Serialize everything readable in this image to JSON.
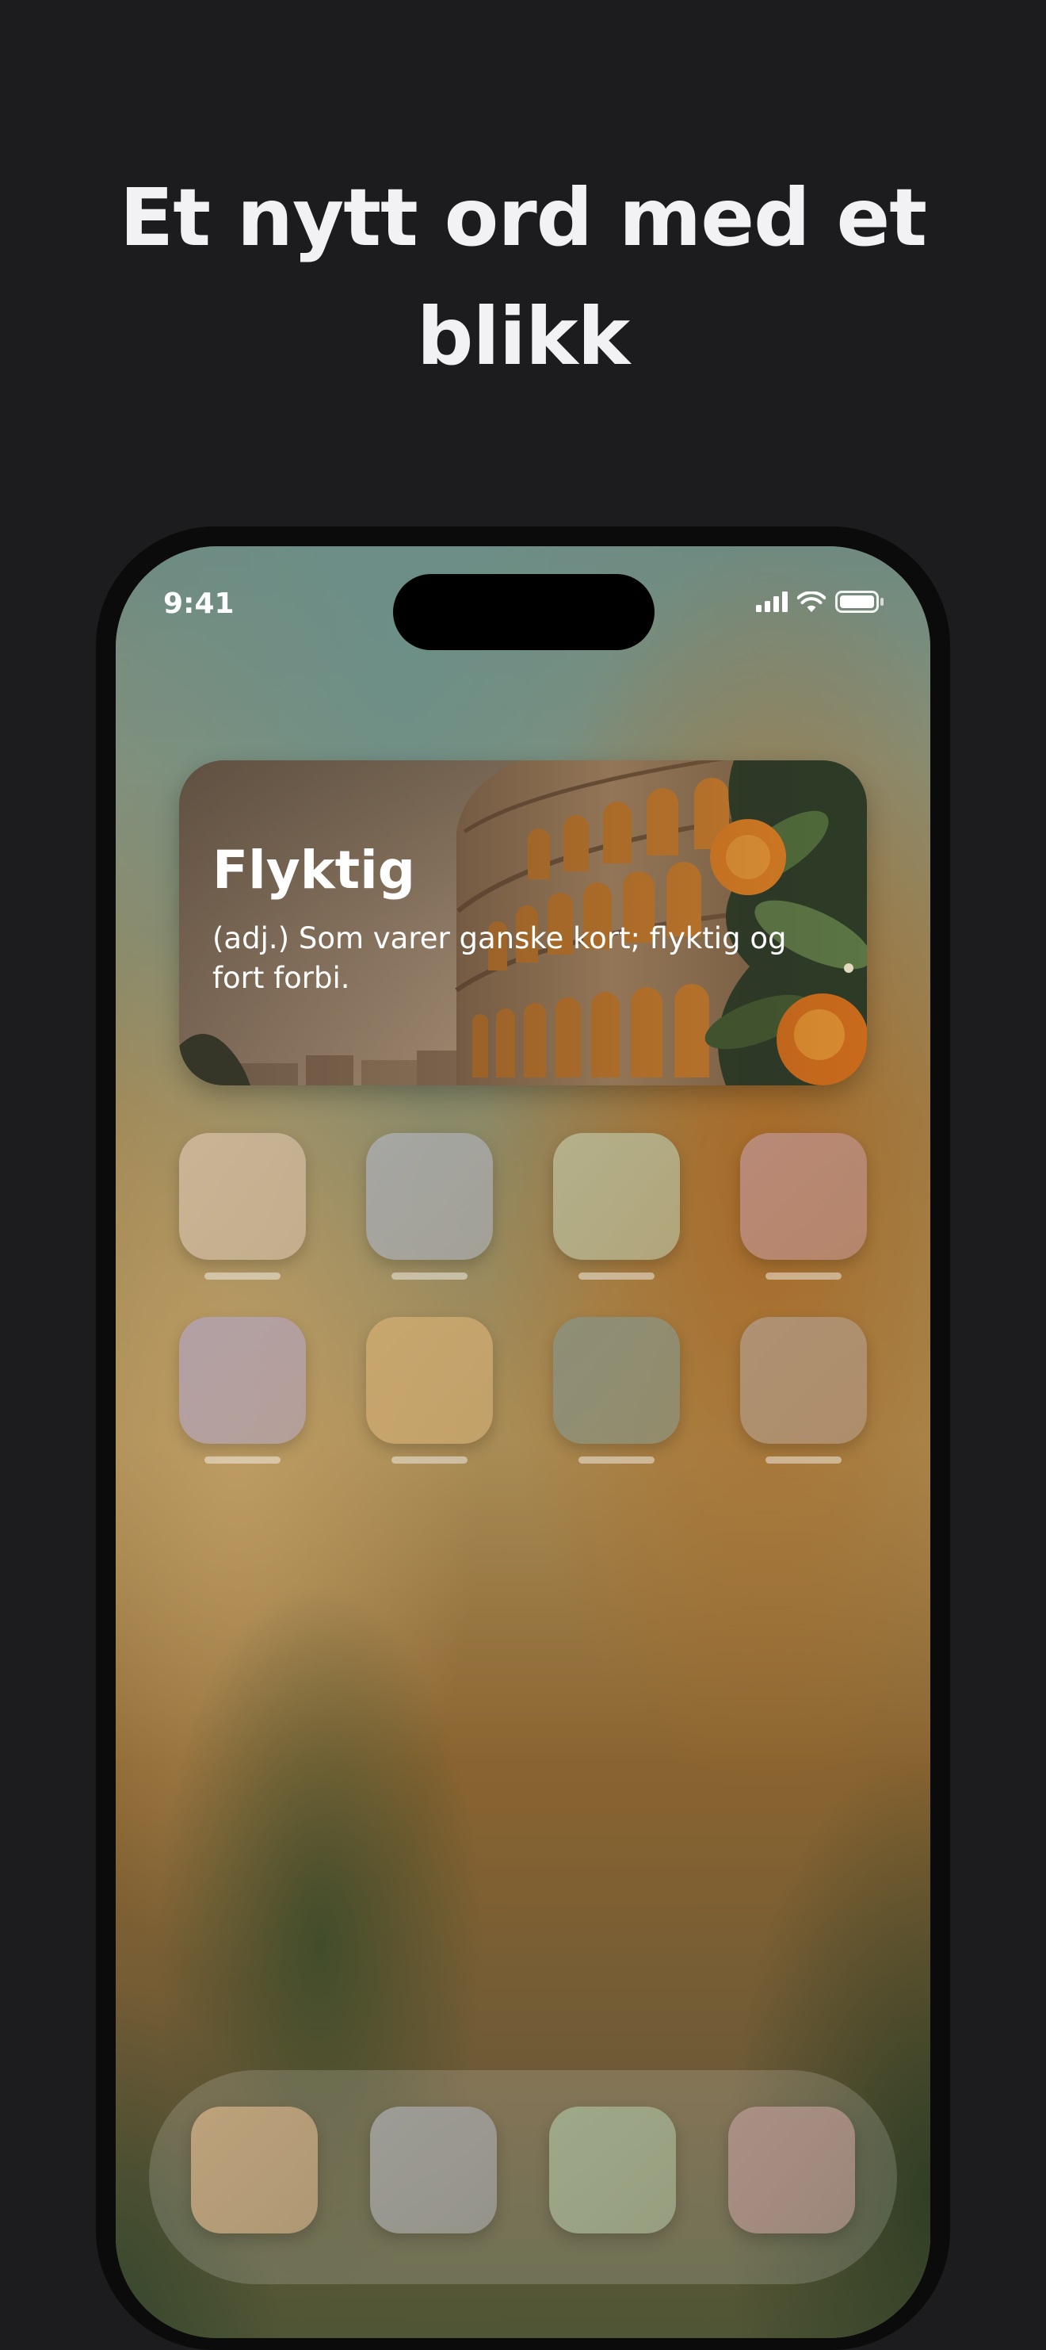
{
  "headline": "Et nytt ord med et blikk",
  "status_bar": {
    "time": "9:41"
  },
  "widget": {
    "word": "Flyktig",
    "definition": "(adj.) Som varer ganske kort; flyktig og fort forbi."
  },
  "home_apps": [
    {
      "color": "#c9b496"
    },
    {
      "color": "#a6a6a3"
    },
    {
      "color": "#b4b08a"
    },
    {
      "color": "#b98a78"
    },
    {
      "color": "#b3a0a5"
    },
    {
      "color": "#c8a66e"
    },
    {
      "color": "#8e8f76"
    },
    {
      "color": "#af9274"
    }
  ],
  "dock_apps": [
    {
      "color": "#bda27b"
    },
    {
      "color": "#9d9c96"
    },
    {
      "color": "#9ea989"
    },
    {
      "color": "#a98f84"
    }
  ]
}
